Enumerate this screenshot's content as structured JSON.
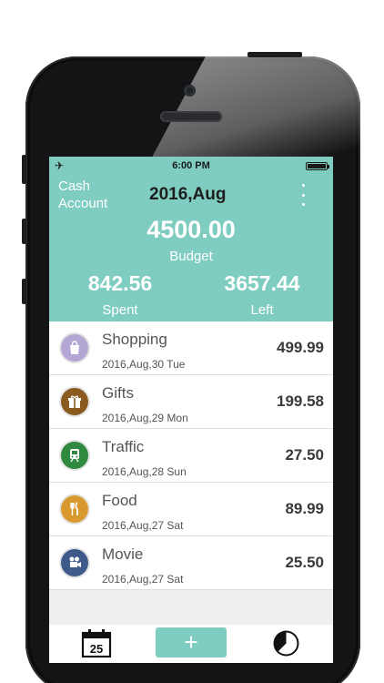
{
  "status_bar": {
    "time": "6:00 PM"
  },
  "header": {
    "account_label": "Cash Account",
    "month": "2016,Aug",
    "budget_value": "4500.00",
    "budget_label": "Budget",
    "spent_value": "842.56",
    "spent_label": "Spent",
    "left_value": "3657.44",
    "left_label": "Left"
  },
  "entries": [
    {
      "name": "Shopping",
      "date": "2016,Aug,30 Tue",
      "amount": "499.99",
      "icon": "shopping-bag-icon",
      "color": "#b3a6d4"
    },
    {
      "name": "Gifts",
      "date": "2016,Aug,29 Mon",
      "amount": "199.58",
      "icon": "gift-icon",
      "color": "#8a5a1f"
    },
    {
      "name": "Traffic",
      "date": "2016,Aug,28 Sun",
      "amount": "27.50",
      "icon": "train-icon",
      "color": "#2f8a3f"
    },
    {
      "name": "Food",
      "date": "2016,Aug,27 Sat",
      "amount": "89.99",
      "icon": "fork-knife-icon",
      "color": "#d89a2e"
    },
    {
      "name": "Movie",
      "date": "2016,Aug,27 Sat",
      "amount": "25.50",
      "icon": "film-camera-icon",
      "color": "#3e5a8a"
    }
  ],
  "tabbar": {
    "calendar_day": "25",
    "add_label": "+"
  },
  "colors": {
    "accent": "#7fcdc0",
    "phone": "#141416",
    "list_bg": "#ffffff"
  }
}
